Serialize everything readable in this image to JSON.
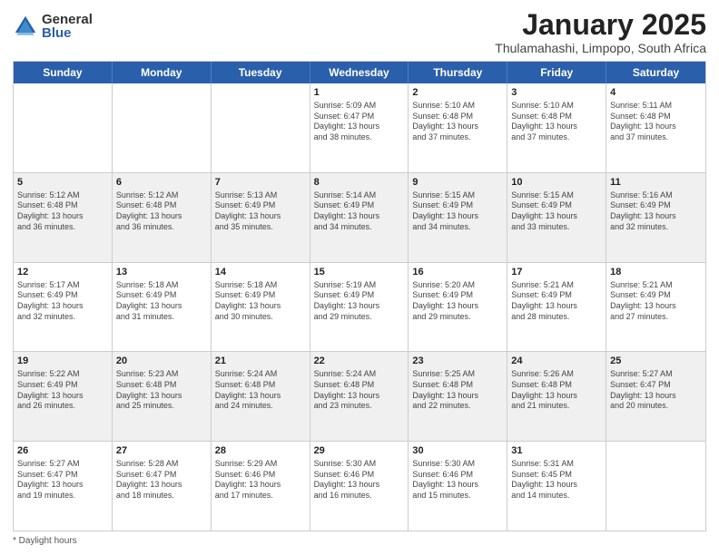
{
  "logo": {
    "general": "General",
    "blue": "Blue"
  },
  "title": "January 2025",
  "subtitle": "Thulamahashi, Limpopo, South Africa",
  "days": [
    "Sunday",
    "Monday",
    "Tuesday",
    "Wednesday",
    "Thursday",
    "Friday",
    "Saturday"
  ],
  "weeks": [
    [
      {
        "day": "",
        "info": ""
      },
      {
        "day": "",
        "info": ""
      },
      {
        "day": "",
        "info": ""
      },
      {
        "day": "1",
        "info": "Sunrise: 5:09 AM\nSunset: 6:47 PM\nDaylight: 13 hours\nand 38 minutes."
      },
      {
        "day": "2",
        "info": "Sunrise: 5:10 AM\nSunset: 6:48 PM\nDaylight: 13 hours\nand 37 minutes."
      },
      {
        "day": "3",
        "info": "Sunrise: 5:10 AM\nSunset: 6:48 PM\nDaylight: 13 hours\nand 37 minutes."
      },
      {
        "day": "4",
        "info": "Sunrise: 5:11 AM\nSunset: 6:48 PM\nDaylight: 13 hours\nand 37 minutes."
      }
    ],
    [
      {
        "day": "5",
        "info": "Sunrise: 5:12 AM\nSunset: 6:48 PM\nDaylight: 13 hours\nand 36 minutes."
      },
      {
        "day": "6",
        "info": "Sunrise: 5:12 AM\nSunset: 6:48 PM\nDaylight: 13 hours\nand 36 minutes."
      },
      {
        "day": "7",
        "info": "Sunrise: 5:13 AM\nSunset: 6:49 PM\nDaylight: 13 hours\nand 35 minutes."
      },
      {
        "day": "8",
        "info": "Sunrise: 5:14 AM\nSunset: 6:49 PM\nDaylight: 13 hours\nand 34 minutes."
      },
      {
        "day": "9",
        "info": "Sunrise: 5:15 AM\nSunset: 6:49 PM\nDaylight: 13 hours\nand 34 minutes."
      },
      {
        "day": "10",
        "info": "Sunrise: 5:15 AM\nSunset: 6:49 PM\nDaylight: 13 hours\nand 33 minutes."
      },
      {
        "day": "11",
        "info": "Sunrise: 5:16 AM\nSunset: 6:49 PM\nDaylight: 13 hours\nand 32 minutes."
      }
    ],
    [
      {
        "day": "12",
        "info": "Sunrise: 5:17 AM\nSunset: 6:49 PM\nDaylight: 13 hours\nand 32 minutes."
      },
      {
        "day": "13",
        "info": "Sunrise: 5:18 AM\nSunset: 6:49 PM\nDaylight: 13 hours\nand 31 minutes."
      },
      {
        "day": "14",
        "info": "Sunrise: 5:18 AM\nSunset: 6:49 PM\nDaylight: 13 hours\nand 30 minutes."
      },
      {
        "day": "15",
        "info": "Sunrise: 5:19 AM\nSunset: 6:49 PM\nDaylight: 13 hours\nand 29 minutes."
      },
      {
        "day": "16",
        "info": "Sunrise: 5:20 AM\nSunset: 6:49 PM\nDaylight: 13 hours\nand 29 minutes."
      },
      {
        "day": "17",
        "info": "Sunrise: 5:21 AM\nSunset: 6:49 PM\nDaylight: 13 hours\nand 28 minutes."
      },
      {
        "day": "18",
        "info": "Sunrise: 5:21 AM\nSunset: 6:49 PM\nDaylight: 13 hours\nand 27 minutes."
      }
    ],
    [
      {
        "day": "19",
        "info": "Sunrise: 5:22 AM\nSunset: 6:49 PM\nDaylight: 13 hours\nand 26 minutes."
      },
      {
        "day": "20",
        "info": "Sunrise: 5:23 AM\nSunset: 6:48 PM\nDaylight: 13 hours\nand 25 minutes."
      },
      {
        "day": "21",
        "info": "Sunrise: 5:24 AM\nSunset: 6:48 PM\nDaylight: 13 hours\nand 24 minutes."
      },
      {
        "day": "22",
        "info": "Sunrise: 5:24 AM\nSunset: 6:48 PM\nDaylight: 13 hours\nand 23 minutes."
      },
      {
        "day": "23",
        "info": "Sunrise: 5:25 AM\nSunset: 6:48 PM\nDaylight: 13 hours\nand 22 minutes."
      },
      {
        "day": "24",
        "info": "Sunrise: 5:26 AM\nSunset: 6:48 PM\nDaylight: 13 hours\nand 21 minutes."
      },
      {
        "day": "25",
        "info": "Sunrise: 5:27 AM\nSunset: 6:47 PM\nDaylight: 13 hours\nand 20 minutes."
      }
    ],
    [
      {
        "day": "26",
        "info": "Sunrise: 5:27 AM\nSunset: 6:47 PM\nDaylight: 13 hours\nand 19 minutes."
      },
      {
        "day": "27",
        "info": "Sunrise: 5:28 AM\nSunset: 6:47 PM\nDaylight: 13 hours\nand 18 minutes."
      },
      {
        "day": "28",
        "info": "Sunrise: 5:29 AM\nSunset: 6:46 PM\nDaylight: 13 hours\nand 17 minutes."
      },
      {
        "day": "29",
        "info": "Sunrise: 5:30 AM\nSunset: 6:46 PM\nDaylight: 13 hours\nand 16 minutes."
      },
      {
        "day": "30",
        "info": "Sunrise: 5:30 AM\nSunset: 6:46 PM\nDaylight: 13 hours\nand 15 minutes."
      },
      {
        "day": "31",
        "info": "Sunrise: 5:31 AM\nSunset: 6:45 PM\nDaylight: 13 hours\nand 14 minutes."
      },
      {
        "day": "",
        "info": ""
      }
    ]
  ],
  "footer": "Daylight hours"
}
